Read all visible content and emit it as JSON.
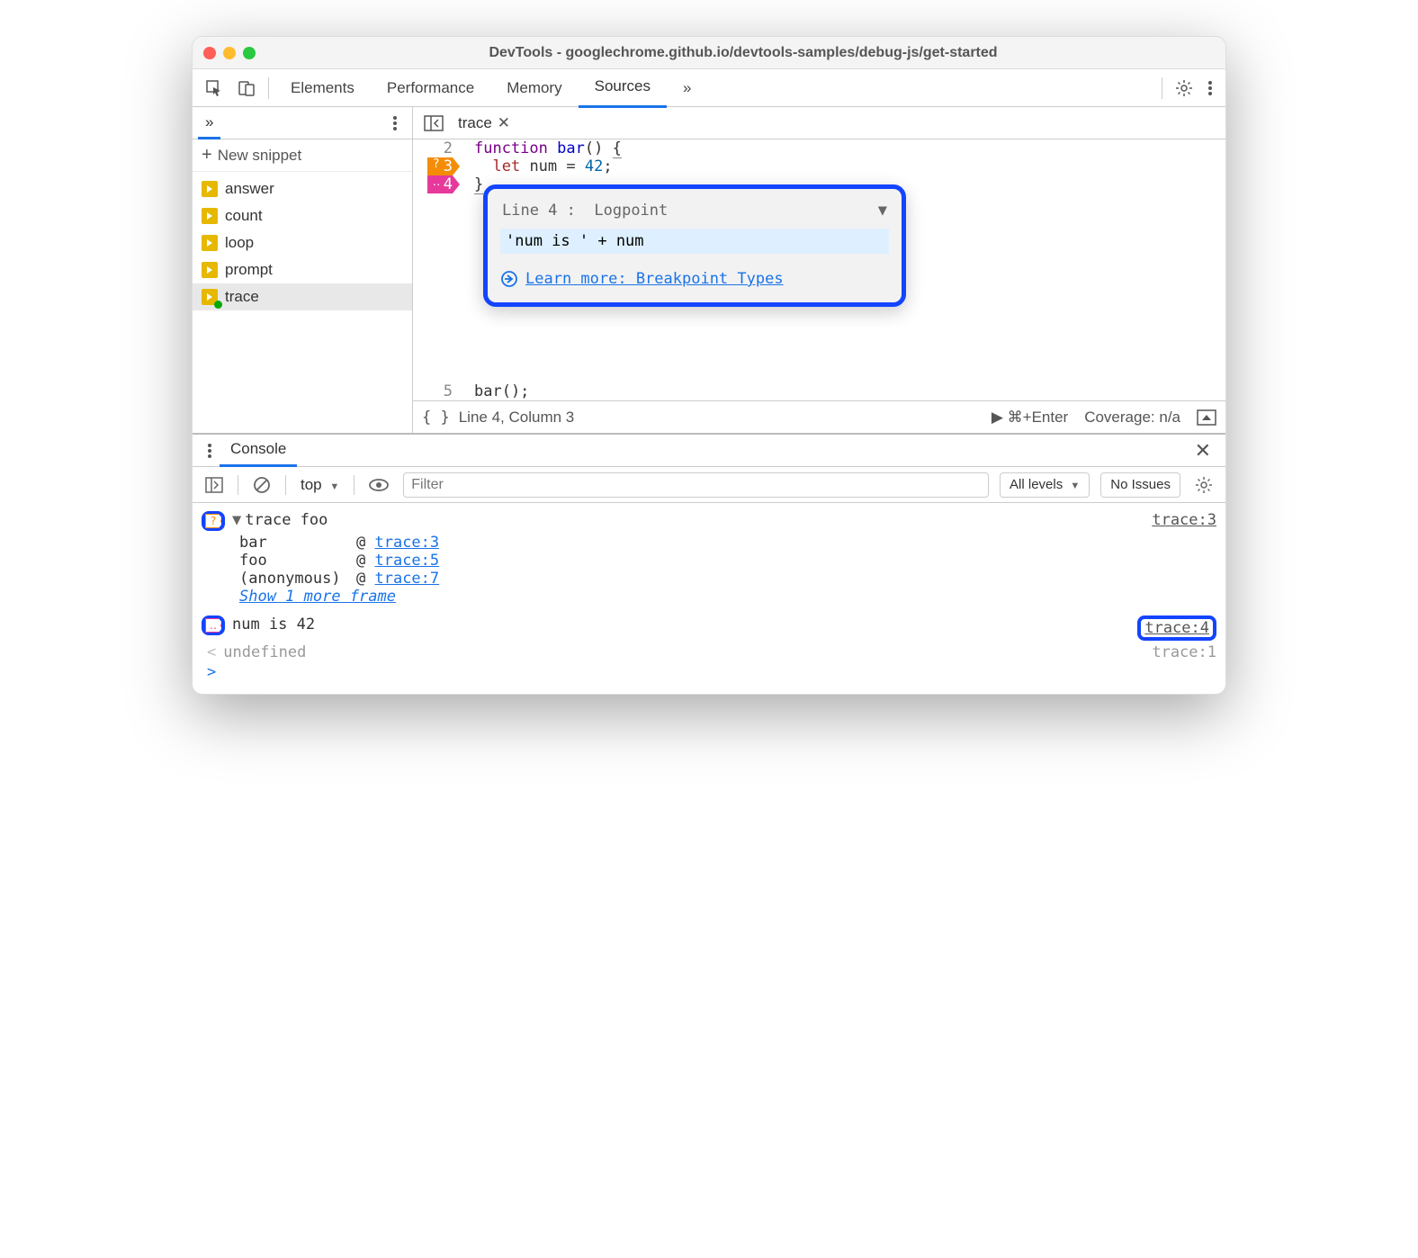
{
  "window": {
    "title": "DevTools - googlechrome.github.io/devtools-samples/debug-js/get-started"
  },
  "main_tabs": {
    "items": [
      "Elements",
      "Performance",
      "Memory",
      "Sources"
    ],
    "active": "Sources",
    "more": "»"
  },
  "sidebar": {
    "overflow": "»",
    "new_snippet_label": "New snippet",
    "files": [
      {
        "name": "answer"
      },
      {
        "name": "count"
      },
      {
        "name": "loop"
      },
      {
        "name": "prompt"
      },
      {
        "name": "trace",
        "selected": true,
        "modified": true
      }
    ]
  },
  "editor": {
    "open_file": "trace",
    "lines": [
      {
        "n": 2,
        "text": "function bar() {"
      },
      {
        "n": 3,
        "text": "  let num = 42;",
        "marker": "orange",
        "glyph": "?"
      },
      {
        "n": 4,
        "text": "}",
        "marker": "pink",
        "glyph": "‥"
      },
      {
        "n": 5,
        "text": "bar();"
      }
    ]
  },
  "popover": {
    "line_label": "Line 4 :",
    "type_label": "Logpoint",
    "expression": "'num is ' + num",
    "learn_more": "Learn more: Breakpoint Types"
  },
  "status_bar": {
    "braces": "{ }",
    "position": "Line 4, Column 3",
    "run_hint": "⌘+Enter",
    "coverage": "Coverage: n/a"
  },
  "console": {
    "tab_label": "Console",
    "toolbar": {
      "context": "top",
      "filter_placeholder": "Filter",
      "levels": "All levels",
      "issues": "No Issues"
    },
    "entries": {
      "trace_msg": "trace foo",
      "trace_src": "trace:3",
      "stack": [
        {
          "fn": "bar",
          "loc": "trace:3"
        },
        {
          "fn": "foo",
          "loc": "trace:5"
        },
        {
          "fn": "(anonymous)",
          "loc": "trace:7"
        }
      ],
      "show_more": "Show 1 more frame",
      "logpoint_msg": "num is 42",
      "logpoint_src": "trace:4",
      "undef": "undefined",
      "undef_src": "trace:1"
    }
  }
}
